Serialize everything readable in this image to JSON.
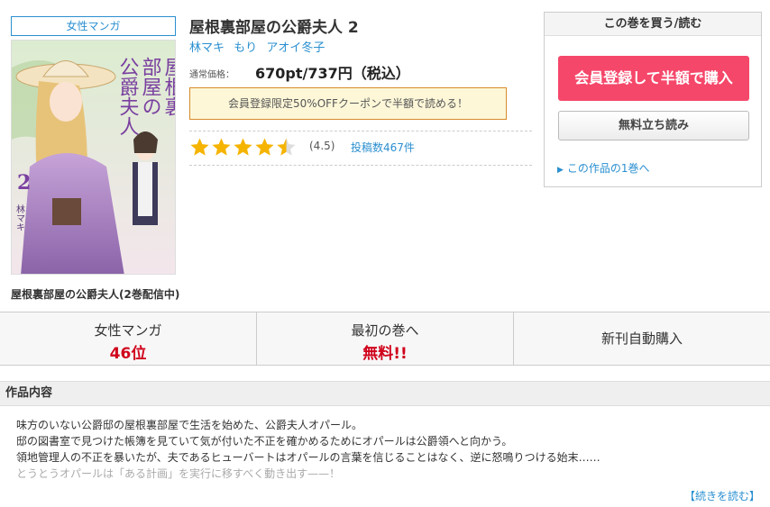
{
  "genre_badge": "女性マンガ",
  "cover": {
    "title_vertical": [
      "屋根裏",
      "部屋の",
      "公爵夫人"
    ],
    "volume_mark": "2",
    "author_mark": "林マキ"
  },
  "series_caption": "屋根裏部屋の公爵夫人(2巻配信中)",
  "title": "屋根裏部屋の公爵夫人 2",
  "authors": [
    "林マキ",
    "もり",
    "アオイ冬子"
  ],
  "price": {
    "label": "通常価格：",
    "value": "670pt/737円（税込）"
  },
  "coupon_text": "会員登録限定50%OFFクーポンで半額で読める！",
  "rating": {
    "score": 4.5,
    "value_text": "(4.5)",
    "review_text": "投稿数467件",
    "star_color": "#f5b400"
  },
  "buy_box": {
    "heading": "この巻を買う/読む",
    "register_button": "会員登録して半額で購入",
    "trial_button": "無料立ち読み",
    "first_volume_link": "この作品の1巻へ"
  },
  "stats": {
    "genre": {
      "label": "女性マンガ",
      "value": "46位"
    },
    "first": {
      "label": "最初の巻へ",
      "value": "無料!!"
    },
    "auto": {
      "label": "新刊自動購入"
    }
  },
  "description": {
    "heading": "作品内容",
    "lines": [
      "味方のいない公爵邸の屋根裏部屋で生活を始めた、公爵夫人オパール。",
      "邸の図書室で見つけた帳簿を見ていて気が付いた不正を確かめるためにオパールは公爵領へと向かう。",
      "領地管理人の不正を暴いたが、夫であるヒューバートはオパールの言葉を信じることはなく、逆に怒鳴りつける始末……",
      "とうとうオパールは「ある計画」を実行に移すべく動き出す——！"
    ],
    "more_link": "【続きを読む】"
  },
  "colors": {
    "accent": "#2a8fd0",
    "buy": "#f5476a",
    "rank": "#d0021b"
  }
}
